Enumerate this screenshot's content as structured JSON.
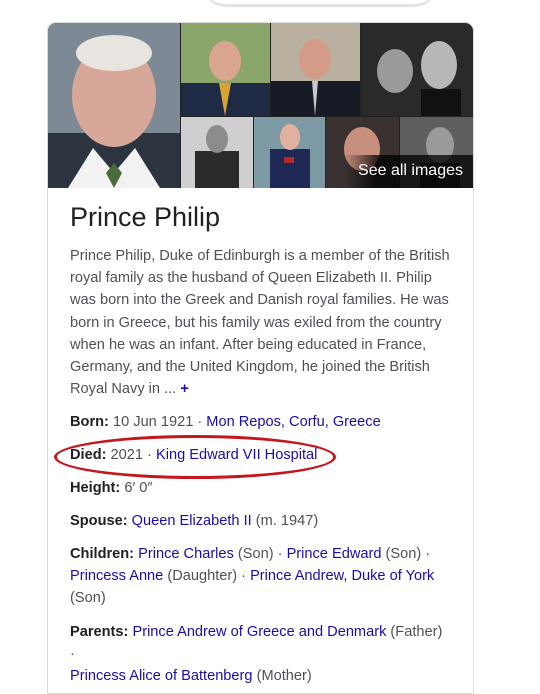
{
  "panel": {
    "see_all_label": "See all images",
    "title": "Prince Philip",
    "description": "Prince Philip, Duke of Edinburgh is a member of the British royal family as the husband of Queen Elizabeth II. Philip was born into the Greek and Danish royal families. He was born in Greece, but his family was exiled from the country when he was an infant. After being educated in France, Germany, and the United Kingdom, he joined the British Royal Navy in ...",
    "more_symbol": "+",
    "facts": {
      "born": {
        "label": "Born:",
        "text": "10 Jun 1921 · ",
        "link": "Mon Repos, Corfu, Greece"
      },
      "died": {
        "label": "Died:",
        "text": "2021 · ",
        "link": "King Edward VII Hospital"
      },
      "height": {
        "label": "Height:",
        "text": "6′ 0″"
      },
      "spouse": {
        "label": "Spouse:",
        "link": "Queen Elizabeth II",
        "text": " (m. 1947)"
      },
      "children": {
        "label": "Children:",
        "items": [
          {
            "link": "Prince Charles",
            "note": " (Son) · "
          },
          {
            "link": "Prince Edward",
            "note": " (Son) · "
          },
          {
            "link": "Princess Anne",
            "note": " (Daughter) · "
          },
          {
            "link": "Prince Andrew, Duke of York",
            "note": " (Son)"
          }
        ]
      },
      "parents": {
        "label": "Parents:",
        "items": [
          {
            "link": "Prince Andrew of Greece and Denmark",
            "note": " (Father) · "
          },
          {
            "link": "Princess Alice of Battenberg",
            "note": " (Mother)"
          }
        ]
      }
    }
  },
  "colors": {
    "link": "#1a0dab",
    "text": "#4d5156",
    "annotation_ellipse": "#c4171d"
  }
}
